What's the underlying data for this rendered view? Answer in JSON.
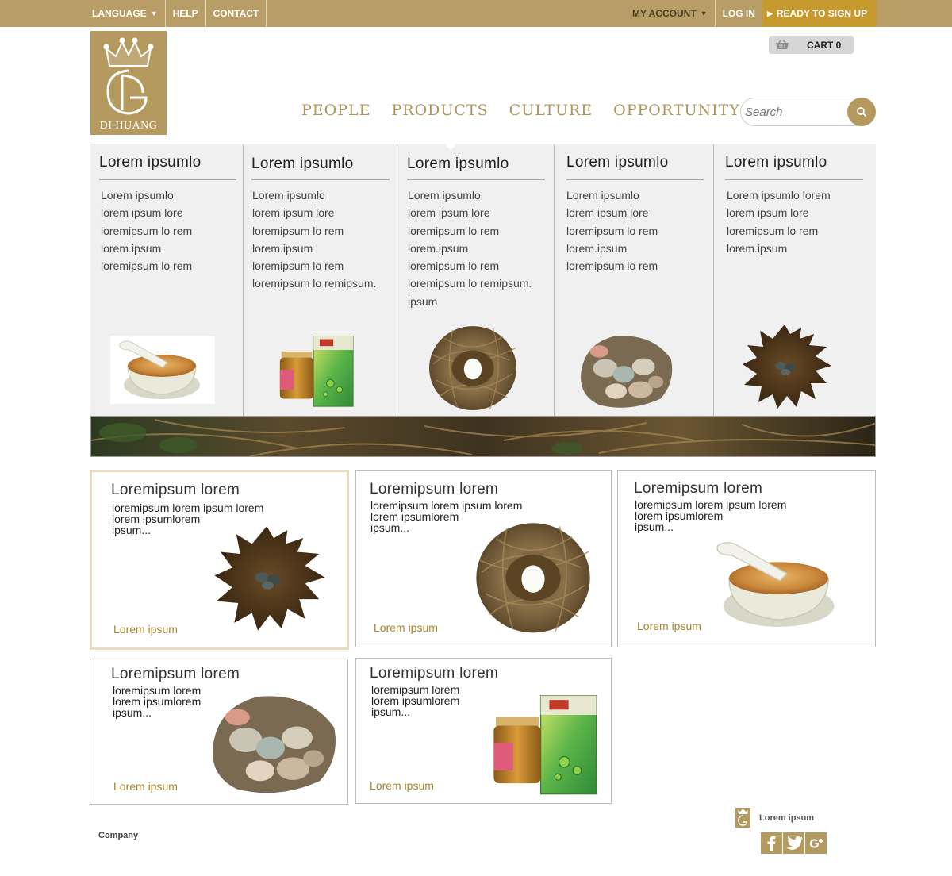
{
  "topbar": {
    "language": "LANGUAGE",
    "help": "HELP",
    "contact": "CONTACT",
    "my_account": "MY ACCOUNT",
    "login": "LOG IN",
    "signup": "READY TO SIGN UP"
  },
  "brand": {
    "name": "DI HUANG"
  },
  "cart": {
    "label": "CART 0"
  },
  "nav": [
    "PEOPLE",
    "PRODUCTS",
    "CULTURE",
    "OPPORTUNITY"
  ],
  "search": {
    "placeholder": "Search"
  },
  "dropdown": [
    {
      "title": "Lorem ipsumlo",
      "items": [
        "Lorem ipsumlo",
        "lorem ipsum lore",
        "loremipsum lo rem",
        "lorem.ipsum",
        "loremipsum lo rem"
      ],
      "image": "bird-nest-soup-bowl"
    },
    {
      "title": "Lorem ipsumlo",
      "items": [
        "Lorem ipsumlo",
        "lorem ipsum lore",
        "loremipsum lo rem",
        "lorem.ipsum",
        "loremipsum lo rem",
        "loremipsum lo remipsum."
      ],
      "image": "chlorella-box-and-jar"
    },
    {
      "title": "Lorem ipsumlo",
      "items": [
        "Lorem ipsumlo",
        "lorem ipsum lore",
        "loremipsum lo rem",
        "lorem.ipsum",
        "loremipsum lo rem",
        "loremipsum lo remipsum.",
        "ipsum"
      ],
      "image": "nest-with-egg"
    },
    {
      "title": "Lorem ipsumlo",
      "items": [
        "Lorem ipsumlo",
        "lorem ipsum lore",
        "loremipsum lo rem",
        "lorem.ipsum",
        "loremipsum lo rem"
      ],
      "image": "shells-and-eggs"
    },
    {
      "title": "Lorem ipsumlo",
      "items": [
        "Lorem ipsumlo lorem",
        "lorem ipsum lore",
        "loremipsum lo rem",
        "lorem.ipsum"
      ],
      "image": "soil-with-stones"
    }
  ],
  "cards": [
    {
      "title": "Loremipsum lorem",
      "desc": [
        "loremipsum lorem ipsum lorem",
        "lorem ipsumlorem",
        "ipsum..."
      ],
      "link": "Lorem ipsum",
      "image": "soil-with-stones"
    },
    {
      "title": "Loremipsum lorem",
      "desc": [
        "loremipsum lorem ipsum lorem",
        "lorem ipsumlorem",
        "ipsum..."
      ],
      "link": "Lorem ipsum",
      "image": "nest-with-egg"
    },
    {
      "title": "Loremipsum lorem",
      "desc": [
        "loremipsum lorem ipsum lorem",
        "lorem ipsumlorem",
        "ipsum..."
      ],
      "link": "Lorem ipsum",
      "image": "bird-nest-soup-bowl"
    },
    {
      "title": "Loremipsum lorem",
      "desc": [
        "loremipsum lorem",
        "lorem ipsumlorem",
        "ipsum..."
      ],
      "link": "Lorem ipsum",
      "image": "shells-and-eggs"
    },
    {
      "title": "Loremipsum lorem",
      "desc": [
        "loremipsum lorem",
        "lorem ipsumlorem",
        "ipsum..."
      ],
      "link": "Lorem ipsum",
      "image": "chlorella-box-and-jar"
    }
  ],
  "footer": {
    "company": "Company",
    "label": "Lorem ipsum",
    "social": [
      "facebook-icon",
      "twitter-icon",
      "google-plus-icon"
    ]
  },
  "colors": {
    "gold": "#b89e66",
    "signup": "#c79a2f",
    "nav_text": "#b0955b",
    "link": "#a7862c"
  }
}
